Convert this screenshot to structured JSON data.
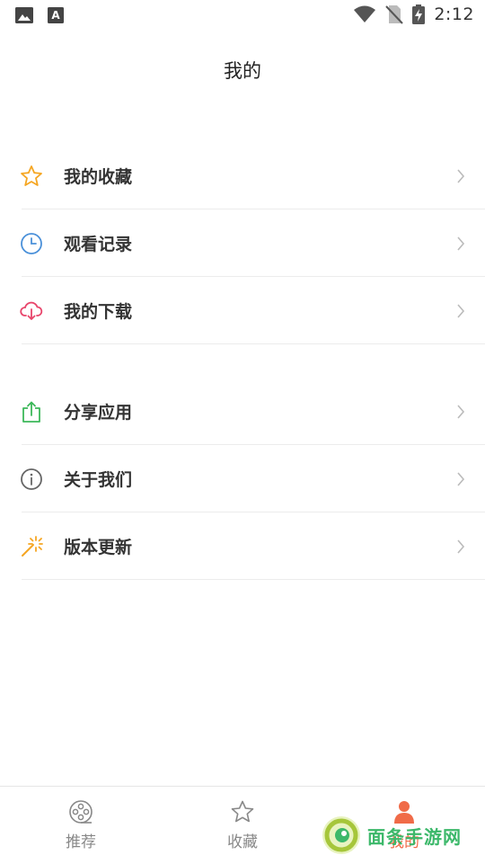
{
  "status_bar": {
    "time": "2:12",
    "left_icons": [
      "image-icon",
      "text-a-icon"
    ],
    "right_icons": [
      "wifi-icon",
      "no-sim-icon",
      "battery-charging-icon"
    ]
  },
  "header": {
    "title": "我的"
  },
  "menu_groups": [
    {
      "items": [
        {
          "label": "我的收藏",
          "icon": "star-icon",
          "color": "#f5a623"
        },
        {
          "label": "观看记录",
          "icon": "clock-icon",
          "color": "#4a90d9"
        },
        {
          "label": "我的下载",
          "icon": "cloud-download-icon",
          "color": "#e8456b"
        }
      ]
    },
    {
      "items": [
        {
          "label": "分享应用",
          "icon": "share-icon",
          "color": "#3cb85a"
        },
        {
          "label": "关于我们",
          "icon": "info-icon",
          "color": "#666666"
        },
        {
          "label": "版本更新",
          "icon": "magic-wand-icon",
          "color": "#f5a623"
        }
      ]
    }
  ],
  "tab_bar": {
    "tabs": [
      {
        "label": "推荐",
        "icon": "film-reel-icon"
      },
      {
        "label": "收藏",
        "icon": "star-outline-icon"
      },
      {
        "label": "我的",
        "icon": "person-icon",
        "active": true,
        "accent": "#f06b48"
      }
    ]
  },
  "watermark": {
    "text": "面条手游网"
  }
}
